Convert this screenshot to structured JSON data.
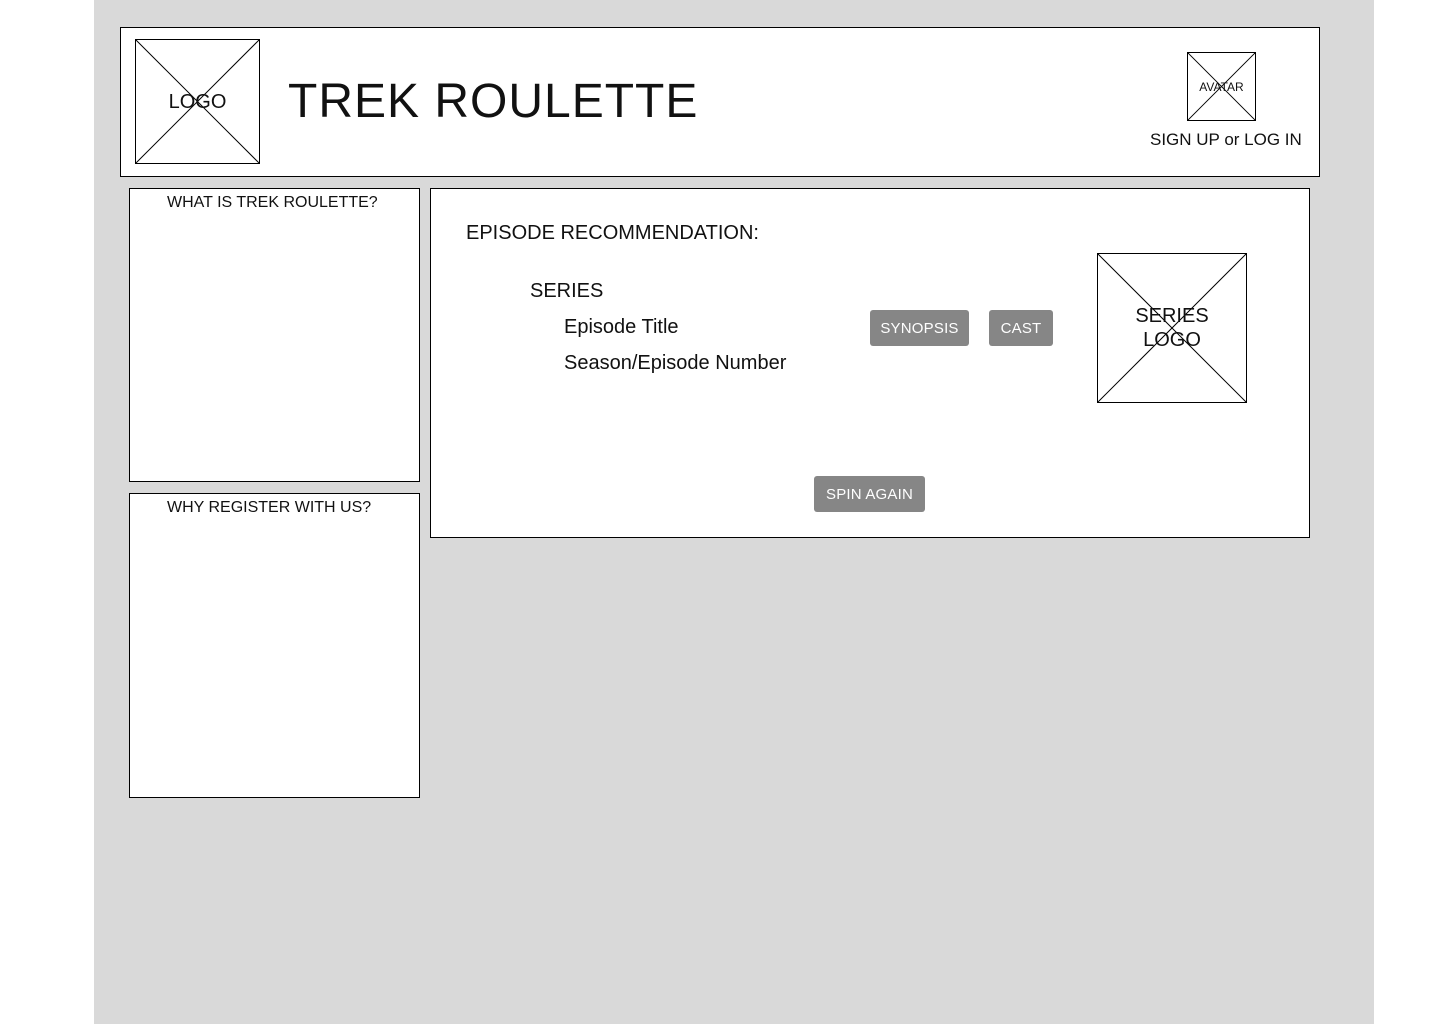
{
  "header": {
    "logo_label": "LOGO",
    "title": "TREK ROULETTE",
    "avatar_label": "AVATAR",
    "auth_link": "SIGN UP or LOG IN"
  },
  "sidebar": {
    "about_heading": "WHAT IS TREK ROULETTE?",
    "register_heading": "WHY REGISTER WITH US?"
  },
  "recommendation": {
    "heading": "EPISODE RECOMMENDATION:",
    "series": "SERIES",
    "episode_title": "Episode Title",
    "season_episode": "Season/Episode Number",
    "synopsis_button": "SYNOPSIS",
    "cast_button": "CAST",
    "series_logo_line1": "SERIES",
    "series_logo_line2": "LOGO",
    "spin_button": "SPIN AGAIN"
  }
}
